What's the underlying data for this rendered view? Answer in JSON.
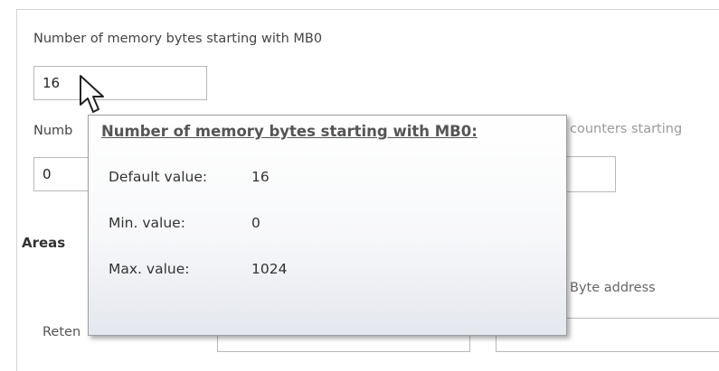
{
  "form": {
    "memory_bytes_label": "Number of memory bytes starting with MB0",
    "memory_bytes_value": "16",
    "timers_label_visible": "Numb",
    "timers_value": "0",
    "counters_label_visible": "counters starting",
    "areas_heading": "Areas",
    "byte_address_header": "Byte address",
    "retentive_label_visible": "Reten"
  },
  "tooltip": {
    "title": "Number of memory bytes starting with MB0:",
    "rows": [
      {
        "key": "Default value:",
        "value": "16"
      },
      {
        "key": "Min. value:",
        "value": "0"
      },
      {
        "key": "Max. value:",
        "value": "1024"
      }
    ]
  },
  "cursor": {
    "icon": "arrow-pointer-icon"
  }
}
